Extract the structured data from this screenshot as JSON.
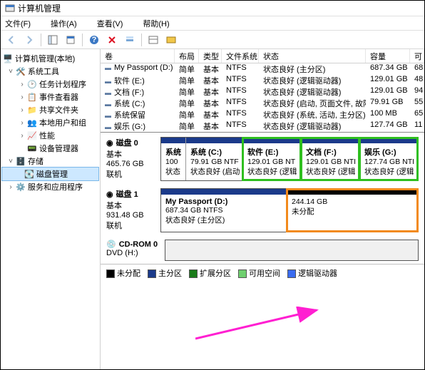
{
  "title": "计算机管理",
  "menu": {
    "file": "文件(F)",
    "action": "操作(A)",
    "view": "查看(V)",
    "help": "帮助(H)"
  },
  "tree": {
    "root": "计算机管理(本地)",
    "systools": "系统工具",
    "tasks": "任务计划程序",
    "eventv": "事件查看器",
    "shared": "共享文件夹",
    "users": "本地用户和组",
    "perf": "性能",
    "devmgr": "设备管理器",
    "storage": "存储",
    "diskmgmt": "磁盘管理",
    "services": "服务和应用程序"
  },
  "cols": {
    "vol": "卷",
    "layout": "布局",
    "type": "类型",
    "fs": "文件系统",
    "status": "状态",
    "cap": "容量",
    "free": "可"
  },
  "rows": [
    {
      "vol": "My Passport (D:)",
      "layout": "简单",
      "type": "基本",
      "fs": "NTFS",
      "status": "状态良好 (主分区)",
      "cap": "687.34 GB",
      "free": "68"
    },
    {
      "vol": "软件 (E:)",
      "layout": "简单",
      "type": "基本",
      "fs": "NTFS",
      "status": "状态良好 (逻辑驱动器)",
      "cap": "129.01 GB",
      "free": "48"
    },
    {
      "vol": "文档 (F:)",
      "layout": "简单",
      "type": "基本",
      "fs": "NTFS",
      "status": "状态良好 (逻辑驱动器)",
      "cap": "129.01 GB",
      "free": "94"
    },
    {
      "vol": "系统 (C:)",
      "layout": "简单",
      "type": "基本",
      "fs": "NTFS",
      "status": "状态良好 (启动, 页面文件, 故障转储, 主分区)",
      "cap": "79.91 GB",
      "free": "55"
    },
    {
      "vol": "系统保留",
      "layout": "简单",
      "type": "基本",
      "fs": "NTFS",
      "status": "状态良好 (系统, 活动, 主分区)",
      "cap": "100 MB",
      "free": "65"
    },
    {
      "vol": "娱乐 (G:)",
      "layout": "简单",
      "type": "基本",
      "fs": "NTFS",
      "status": "状态良好 (逻辑驱动器)",
      "cap": "127.74 GB",
      "free": "11"
    }
  ],
  "disk0": {
    "title": "磁盘 0",
    "kind": "基本",
    "size": "465.76 GB",
    "state": "联机",
    "parts": [
      {
        "name": "系统",
        "l2": "100",
        "l3": "状态",
        "color": "#1b3a8a",
        "hl": ""
      },
      {
        "name": "系统  (C:)",
        "l2": "79.91 GB NTF",
        "l3": "状态良好 (启动",
        "color": "#1b3a8a",
        "hl": ""
      },
      {
        "name": "软件  (E:)",
        "l2": "129.01 GB NT",
        "l3": "状态良好 (逻辑",
        "color": "#1b3a8a",
        "hl": "green"
      },
      {
        "name": "文档  (F:)",
        "l2": "129.01 GB NTI",
        "l3": "状态良好 (逻辑",
        "color": "#1b3a8a",
        "hl": "green"
      },
      {
        "name": "娱乐  (G:)",
        "l2": "127.74 GB NTI",
        "l3": "状态良好 (逻辑",
        "color": "#1b3a8a",
        "hl": "green"
      }
    ]
  },
  "disk1": {
    "title": "磁盘 1",
    "kind": "基本",
    "size": "931.48 GB",
    "state": "联机",
    "parts": [
      {
        "name": "My Passport  (D:)",
        "l2": "687.34 GB NTFS",
        "l3": "状态良好 (主分区)",
        "color": "#1b3a8a",
        "hl": ""
      },
      {
        "name": "",
        "l2": "244.14 GB",
        "l3": "未分配",
        "color": "#000",
        "hl": "orange"
      }
    ]
  },
  "cdrom": {
    "title": "CD-ROM 0",
    "sub": "DVD (H:)"
  },
  "legend": {
    "unalloc": "未分配",
    "primary": "主分区",
    "ext": "扩展分区",
    "free": "可用空间",
    "logical": "逻辑驱动器"
  },
  "legend_colors": {
    "unalloc": "#000",
    "primary": "#1b3a8a",
    "ext": "#1a7c1a",
    "free": "#6fcf6f",
    "logical": "#3a6cf0"
  }
}
